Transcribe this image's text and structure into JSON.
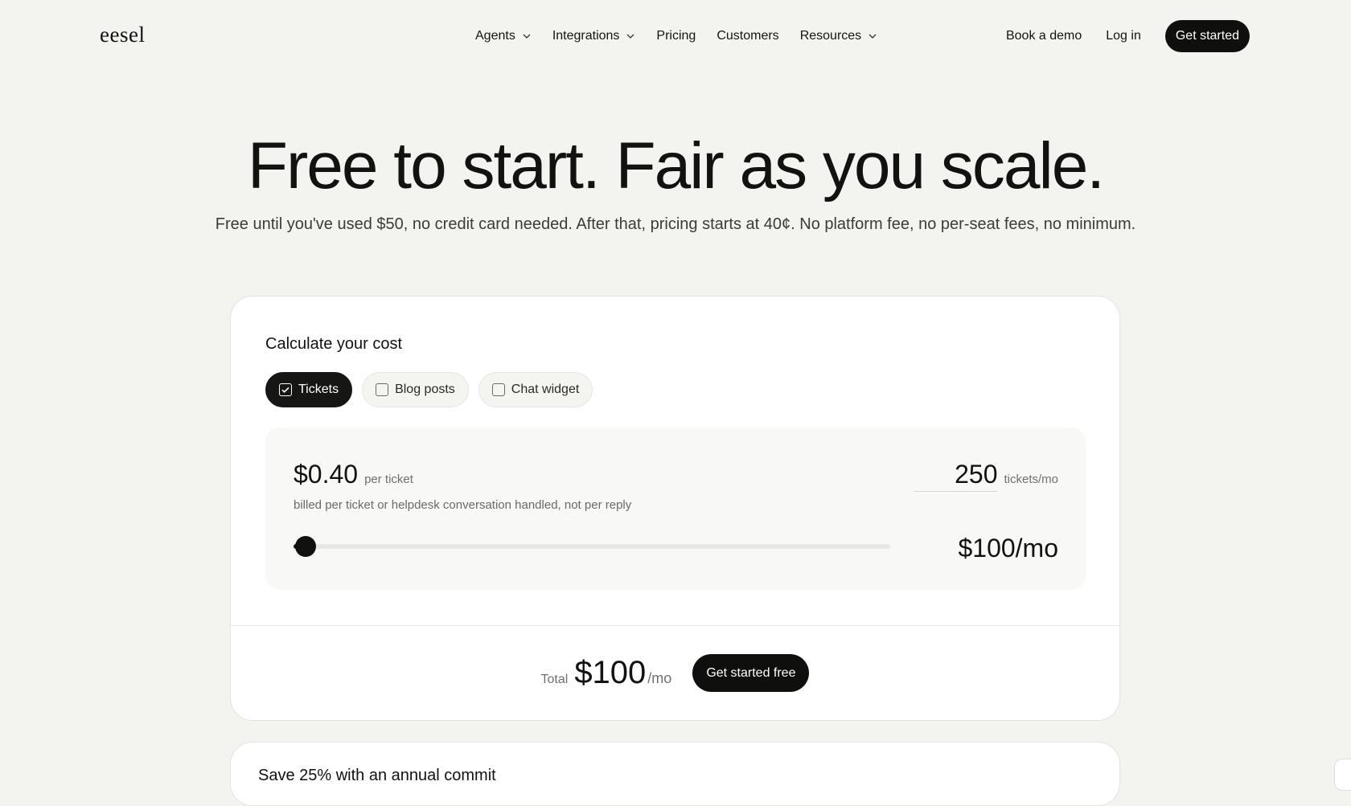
{
  "nav": {
    "logo": "eesel",
    "items": [
      {
        "label": "Agents",
        "dropdown": true
      },
      {
        "label": "Integrations",
        "dropdown": true
      },
      {
        "label": "Pricing",
        "dropdown": false
      },
      {
        "label": "Customers",
        "dropdown": false
      },
      {
        "label": "Resources",
        "dropdown": true
      }
    ],
    "book_demo": "Book a demo",
    "login": "Log in",
    "get_started": "Get started"
  },
  "hero": {
    "title": "Free to start. Fair as you scale.",
    "subtitle": "Free until you've used $50, no credit card needed. After that, pricing starts at 40¢. No platform fee, no per-seat fees, no minimum."
  },
  "calculator": {
    "title": "Calculate your cost",
    "chips": [
      {
        "label": "Tickets",
        "checked": true
      },
      {
        "label": "Blog posts",
        "checked": false
      },
      {
        "label": "Chat widget",
        "checked": false
      }
    ],
    "price": "$0.40",
    "price_unit": "per ticket",
    "billed_note": "billed per ticket or helpdesk conversation handled, not per reply",
    "quantity": "250",
    "quantity_unit": "tickets/mo",
    "slider_level": 0.02,
    "monthly": "$100/mo"
  },
  "total": {
    "label": "Total",
    "value": "$100",
    "unit": "/mo",
    "cta": "Get started free"
  },
  "annual": {
    "title": "Save 25% with an annual commit"
  },
  "colors": {
    "background": "#f3f3ef",
    "accent": "#0f0f0e"
  }
}
